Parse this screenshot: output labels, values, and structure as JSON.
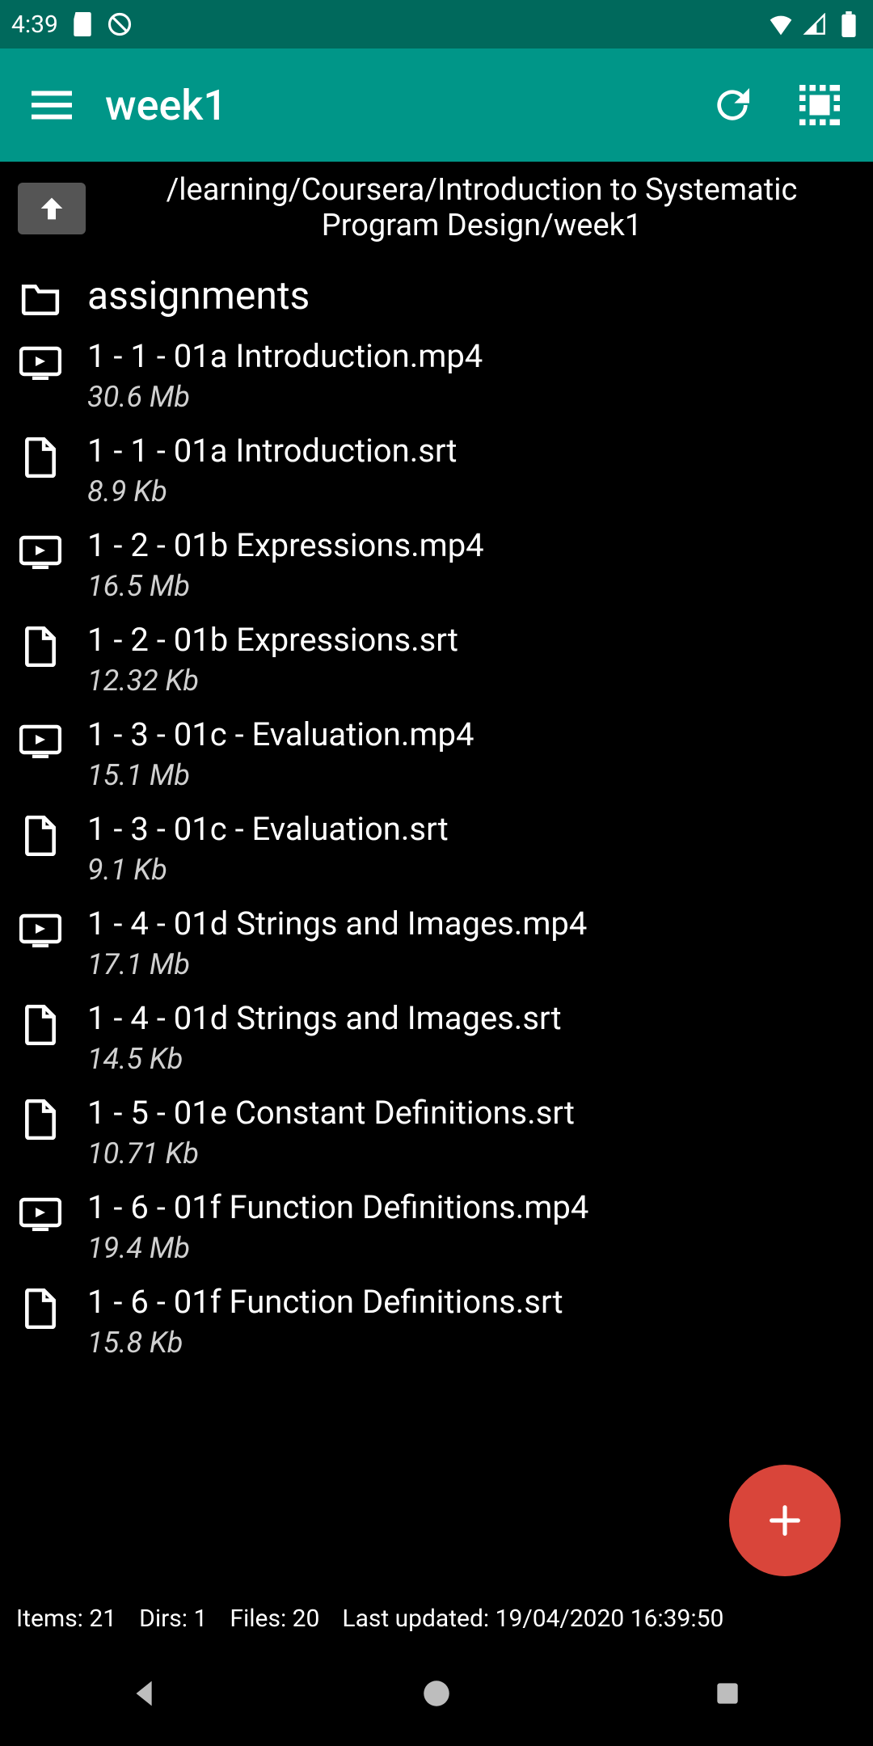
{
  "status": {
    "time": "4:39"
  },
  "appbar": {
    "title": "week1"
  },
  "path": "/learning/Coursera/Introduction to Systematic Program Design/week1",
  "folder": {
    "name": "assignments"
  },
  "files": [
    {
      "type": "video",
      "name": "1 - 1 - 01a Introduction.mp4",
      "size": "30.6 Mb"
    },
    {
      "type": "file",
      "name": "1 - 1 - 01a Introduction.srt",
      "size": "8.9 Kb"
    },
    {
      "type": "video",
      "name": "1 - 2 - 01b Expressions.mp4",
      "size": "16.5 Mb"
    },
    {
      "type": "file",
      "name": "1 - 2 - 01b Expressions.srt",
      "size": "12.32 Kb"
    },
    {
      "type": "video",
      "name": "1 - 3 - 01c - Evaluation.mp4",
      "size": "15.1 Mb"
    },
    {
      "type": "file",
      "name": "1 - 3 - 01c - Evaluation.srt",
      "size": "9.1 Kb"
    },
    {
      "type": "video",
      "name": "1 - 4 - 01d Strings and Images.mp4",
      "size": "17.1 Mb"
    },
    {
      "type": "file",
      "name": "1 - 4 - 01d Strings and Images.srt",
      "size": "14.5 Kb"
    },
    {
      "type": "file",
      "name": "1 - 5 - 01e Constant Definitions.srt",
      "size": "10.71 Kb"
    },
    {
      "type": "video",
      "name": "1 - 6 - 01f Function Definitions.mp4",
      "size": "19.4 Mb"
    },
    {
      "type": "file",
      "name": "1 - 6 - 01f Function Definitions.srt",
      "size": "15.8 Kb"
    }
  ],
  "footer": {
    "items_label": "Items:",
    "items": "21",
    "dirs_label": "Dirs:",
    "dirs": "1",
    "files_label": "Files:",
    "files": "20",
    "updated_label": "Last updated:",
    "updated": "19/04/2020 16:39:50"
  }
}
